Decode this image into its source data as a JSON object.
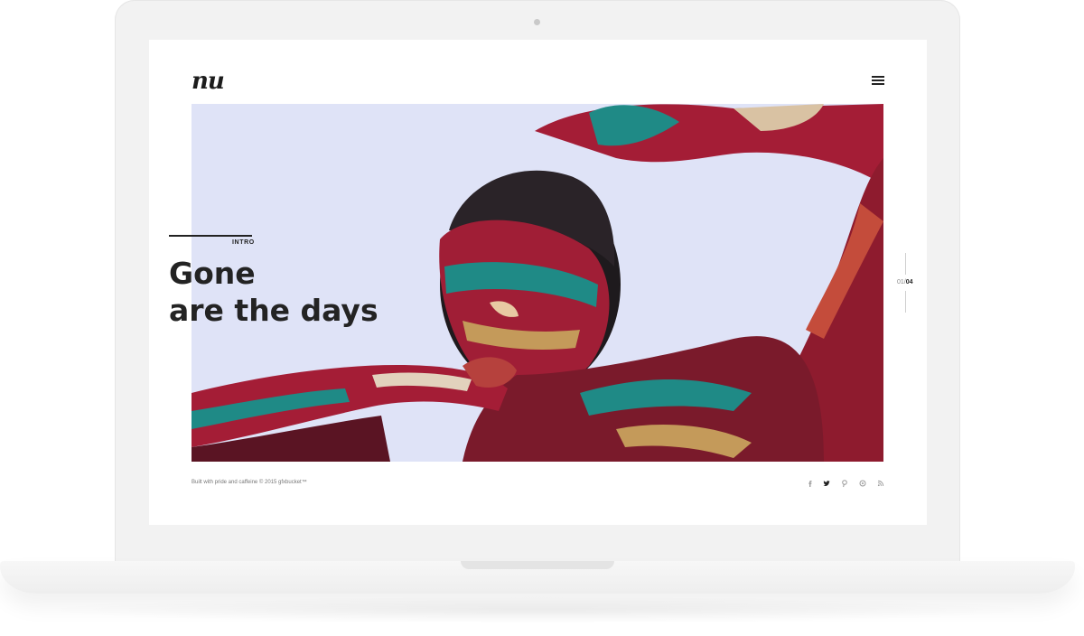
{
  "site": {
    "logo": "nu",
    "menu_icon": "hamburger-menu-icon"
  },
  "hero": {
    "section_label": "INTRO",
    "headline_line1": "Gone",
    "headline_line2": "are the days",
    "background_color": "#dfe3f7",
    "image_alt": "model with red, teal and gold body paint"
  },
  "pager": {
    "current": "01",
    "separator": "/",
    "total": "04"
  },
  "footer": {
    "credit": "Built with pride and caffeine © 2015 gfxbucket™",
    "social_icons": [
      "facebook-icon",
      "twitter-icon",
      "pinterest-icon",
      "dribbble-icon",
      "rss-icon"
    ]
  },
  "colors": {
    "text_dark": "#232323",
    "paint_red": "#b3203a",
    "paint_teal": "#1f8a86",
    "paint_gold": "#c49a5a"
  }
}
